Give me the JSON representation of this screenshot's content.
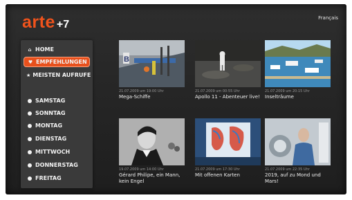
{
  "header": {
    "brand": "arte",
    "brand_suffix": "+7",
    "language": "Français"
  },
  "sidebar": {
    "items": [
      {
        "label": "HOME",
        "icon": "home-icon"
      },
      {
        "label": "EMPFEHLUNGEN",
        "icon": "heart-icon",
        "active": true
      },
      {
        "label": "MEISTEN AUFRUFE",
        "icon": "star-icon"
      },
      {
        "label": "SAMSTAG",
        "icon": "day-icon"
      },
      {
        "label": "SONNTAG",
        "icon": "day-icon"
      },
      {
        "label": "MONTAG",
        "icon": "day-icon"
      },
      {
        "label": "DIENSTAG",
        "icon": "day-icon"
      },
      {
        "label": "MITTWOCH",
        "icon": "day-icon"
      },
      {
        "label": "DONNERSTAG",
        "icon": "day-icon"
      },
      {
        "label": "FREITAG",
        "icon": "day-icon"
      }
    ]
  },
  "videos": [
    {
      "date": "21.07.2009 um 19:00 Uhr",
      "title": "Mega-Schiffe"
    },
    {
      "date": "21.07.2009 um 00:55 Uhr",
      "title": "Apollo 11 - Abenteuer live!"
    },
    {
      "date": "21.07.2009 um 20:15 Uhr",
      "title": "Inselträume"
    },
    {
      "date": "19.07.2009 um 14:00 Uhr",
      "title": "Gérard Philipe, ein Mann, kein Engel"
    },
    {
      "date": "21.07.2009 um 17:30 Uhr",
      "title": "Mit offenen Karten"
    },
    {
      "date": "21.07.2009 um 22:35 Uhr",
      "title": "2019, auf zu Mond und Mars!"
    }
  ],
  "colors": {
    "accent": "#e8501c",
    "brand": "#f0531c",
    "background": "#262626",
    "panel": "#3a3a3a"
  }
}
